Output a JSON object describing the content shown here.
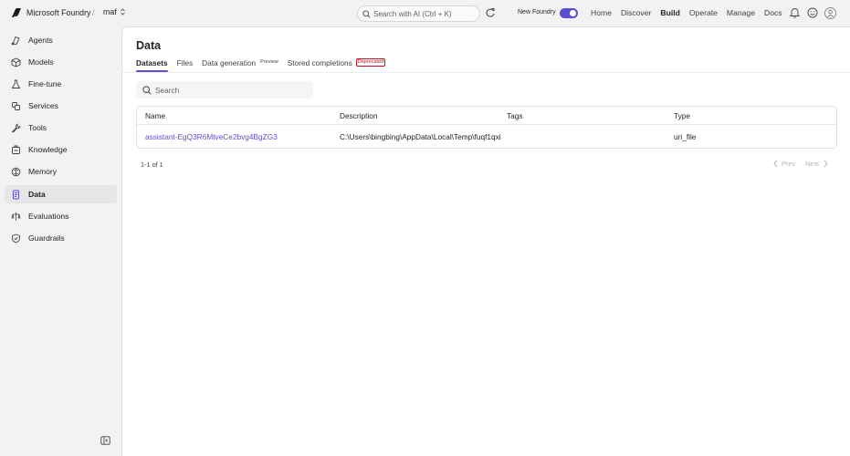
{
  "topbar": {
    "brand": "Microsoft Foundry",
    "separator": "/",
    "project": "maf",
    "search_placeholder": "Search with AI (Ctrl + K)",
    "new_foundry_label": "New Foundry",
    "new_foundry_on": true,
    "nav": [
      "Home",
      "Discover",
      "Build",
      "Operate",
      "Manage",
      "Docs"
    ],
    "active_nav": "Build"
  },
  "sidebar": {
    "items": [
      {
        "label": "Agents",
        "icon": "agents-icon"
      },
      {
        "label": "Models",
        "icon": "cube-icon"
      },
      {
        "label": "Fine-tune",
        "icon": "flask-icon"
      },
      {
        "label": "Services",
        "icon": "services-icon"
      },
      {
        "label": "Tools",
        "icon": "wrench-icon"
      },
      {
        "label": "Knowledge",
        "icon": "knowledge-icon"
      },
      {
        "label": "Memory",
        "icon": "memory-icon"
      },
      {
        "label": "Data",
        "icon": "data-icon"
      },
      {
        "label": "Evaluations",
        "icon": "evaluations-icon"
      },
      {
        "label": "Guardrails",
        "icon": "shield-icon"
      }
    ],
    "active": "Data"
  },
  "main": {
    "title": "Data",
    "tabs": [
      {
        "label": "Datasets",
        "active": true
      },
      {
        "label": "Files"
      },
      {
        "label": "Data generation",
        "badge": "Preview"
      },
      {
        "label": "Stored completions",
        "badge": "Deprecated"
      }
    ],
    "search_placeholder": "Search",
    "table": {
      "columns": [
        "Name",
        "Description",
        "Tags",
        "Type"
      ],
      "rows": [
        {
          "name": "assistant-EgQ3R6MtveCe2bvg4BgZG3",
          "description": "C:\\Users\\bingbing\\AppData\\Local\\Temp\\fuqf1qxi",
          "tags": "",
          "type": "uri_file"
        }
      ]
    },
    "range_text": "1-1 of 1",
    "prev_label": "Prev",
    "next_label": "Next"
  },
  "colors": {
    "accent": "#5b4fcf",
    "deprecated": "#c50f1f"
  }
}
